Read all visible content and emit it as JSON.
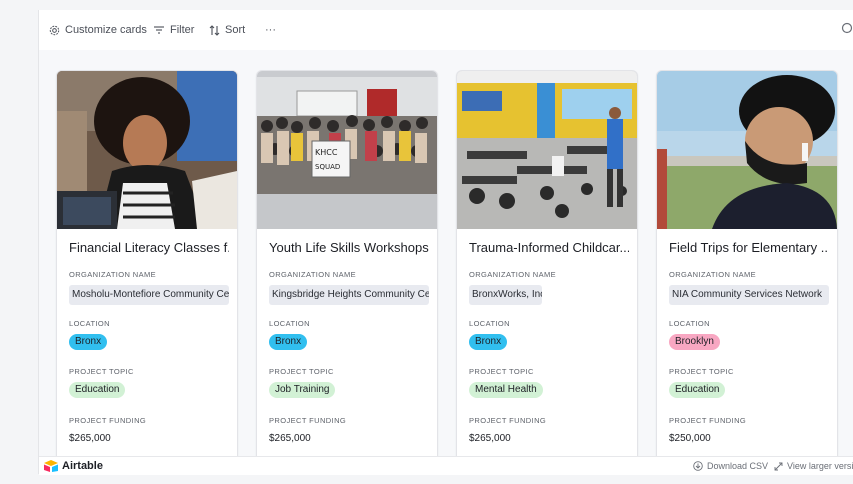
{
  "toolbar": {
    "customize_label": "Customize cards",
    "filter_label": "Filter",
    "sort_label": "Sort",
    "more_label": "···"
  },
  "field_labels": {
    "organization": "ORGANIZATION NAME",
    "location": "LOCATION",
    "topic": "PROJECT TOPIC",
    "funding": "PROJECT FUNDING"
  },
  "cards": [
    {
      "title": "Financial Literacy Classes f...",
      "organization": "Mosholu-Montefiore Community Ce",
      "location": "Bronx",
      "location_color": "#31bfef",
      "topic": "Education",
      "topic_color": "#d2f1d5",
      "funding": "$265,000",
      "image_icon": "photo-student-laptop"
    },
    {
      "title": "Youth Life Skills Workshops",
      "organization": "Kingsbridge Heights Community Ce",
      "location": "Bronx",
      "location_color": "#31bfef",
      "topic": "Job Training",
      "topic_color": "#d2f1d5",
      "funding": "$265,000",
      "image_icon": "photo-group"
    },
    {
      "title": "Trauma-Informed Childcar...",
      "organization": "BronxWorks, Inc",
      "location": "Bronx",
      "location_color": "#31bfef",
      "topic": "Mental Health",
      "topic_color": "#d2f1d5",
      "funding": "$265,000",
      "image_icon": "photo-classroom"
    },
    {
      "title": "Field Trips for Elementary ...",
      "organization": "NIA Community Services Network",
      "location": "Brooklyn",
      "location_color": "#f8a7c2",
      "topic": "Education",
      "topic_color": "#d2f1d5",
      "funding": "$250,000",
      "image_icon": "photo-masked-teen"
    }
  ],
  "footer": {
    "brand": "Airtable",
    "download_label": "Download CSV",
    "view_label": "View larger versio"
  }
}
